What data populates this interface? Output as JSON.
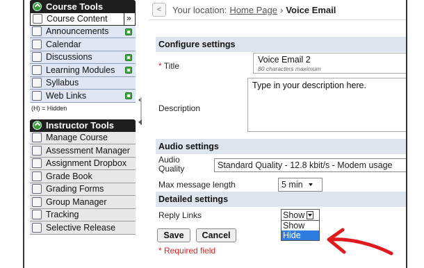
{
  "sidebar": {
    "course_tools_title": "Course Tools",
    "items": [
      {
        "label": "Course Content",
        "selected": true
      },
      {
        "label": "Announcements",
        "add": true
      },
      {
        "label": "Calendar"
      },
      {
        "label": "Discussions",
        "add": true
      },
      {
        "label": "Learning Modules",
        "add": true
      },
      {
        "label": "Syllabus"
      },
      {
        "label": "Web Links",
        "add": true
      }
    ],
    "collapse_glyph": "»",
    "hidden_note": "(H) = Hidden",
    "instructor_tools_title": "Instructor Tools",
    "instructor_items": [
      {
        "label": "Manage Course"
      },
      {
        "label": "Assessment Manager"
      },
      {
        "label": "Assignment Dropbox"
      },
      {
        "label": "Grade Book"
      },
      {
        "label": "Grading Forms"
      },
      {
        "label": "Group Manager"
      },
      {
        "label": "Tracking"
      },
      {
        "label": "Selective Release"
      }
    ]
  },
  "breadcrumb": {
    "back_glyph": "<",
    "prefix": "Your location:",
    "home": "Home Page",
    "separator": "›",
    "current": "Voice Email"
  },
  "configure": {
    "title": "Configure settings",
    "title_label": "Title",
    "required_star": "*",
    "title_value": "Voice Email 2",
    "title_hint": "80 characters maximum",
    "description_label": "Description",
    "description_placeholder": "Type in your description here."
  },
  "audio": {
    "title": "Audio settings",
    "quality_label": "Audio Quality",
    "quality_value": "Standard Quality - 12.8 kbit/s - Modem usage",
    "max_length_label": "Max message length",
    "max_length_value": "5 min"
  },
  "detailed": {
    "title": "Detailed settings",
    "reply_links_label": "Reply Links",
    "reply_links_value": "Show",
    "options": [
      "Show",
      "Hide"
    ],
    "highlighted_option": "Hide"
  },
  "actions": {
    "save": "Save",
    "cancel": "Cancel",
    "required_note": "* Required field"
  },
  "colors": {
    "accent": "#2f7de1",
    "required": "#dd2222",
    "annotation": "#e0191d"
  }
}
